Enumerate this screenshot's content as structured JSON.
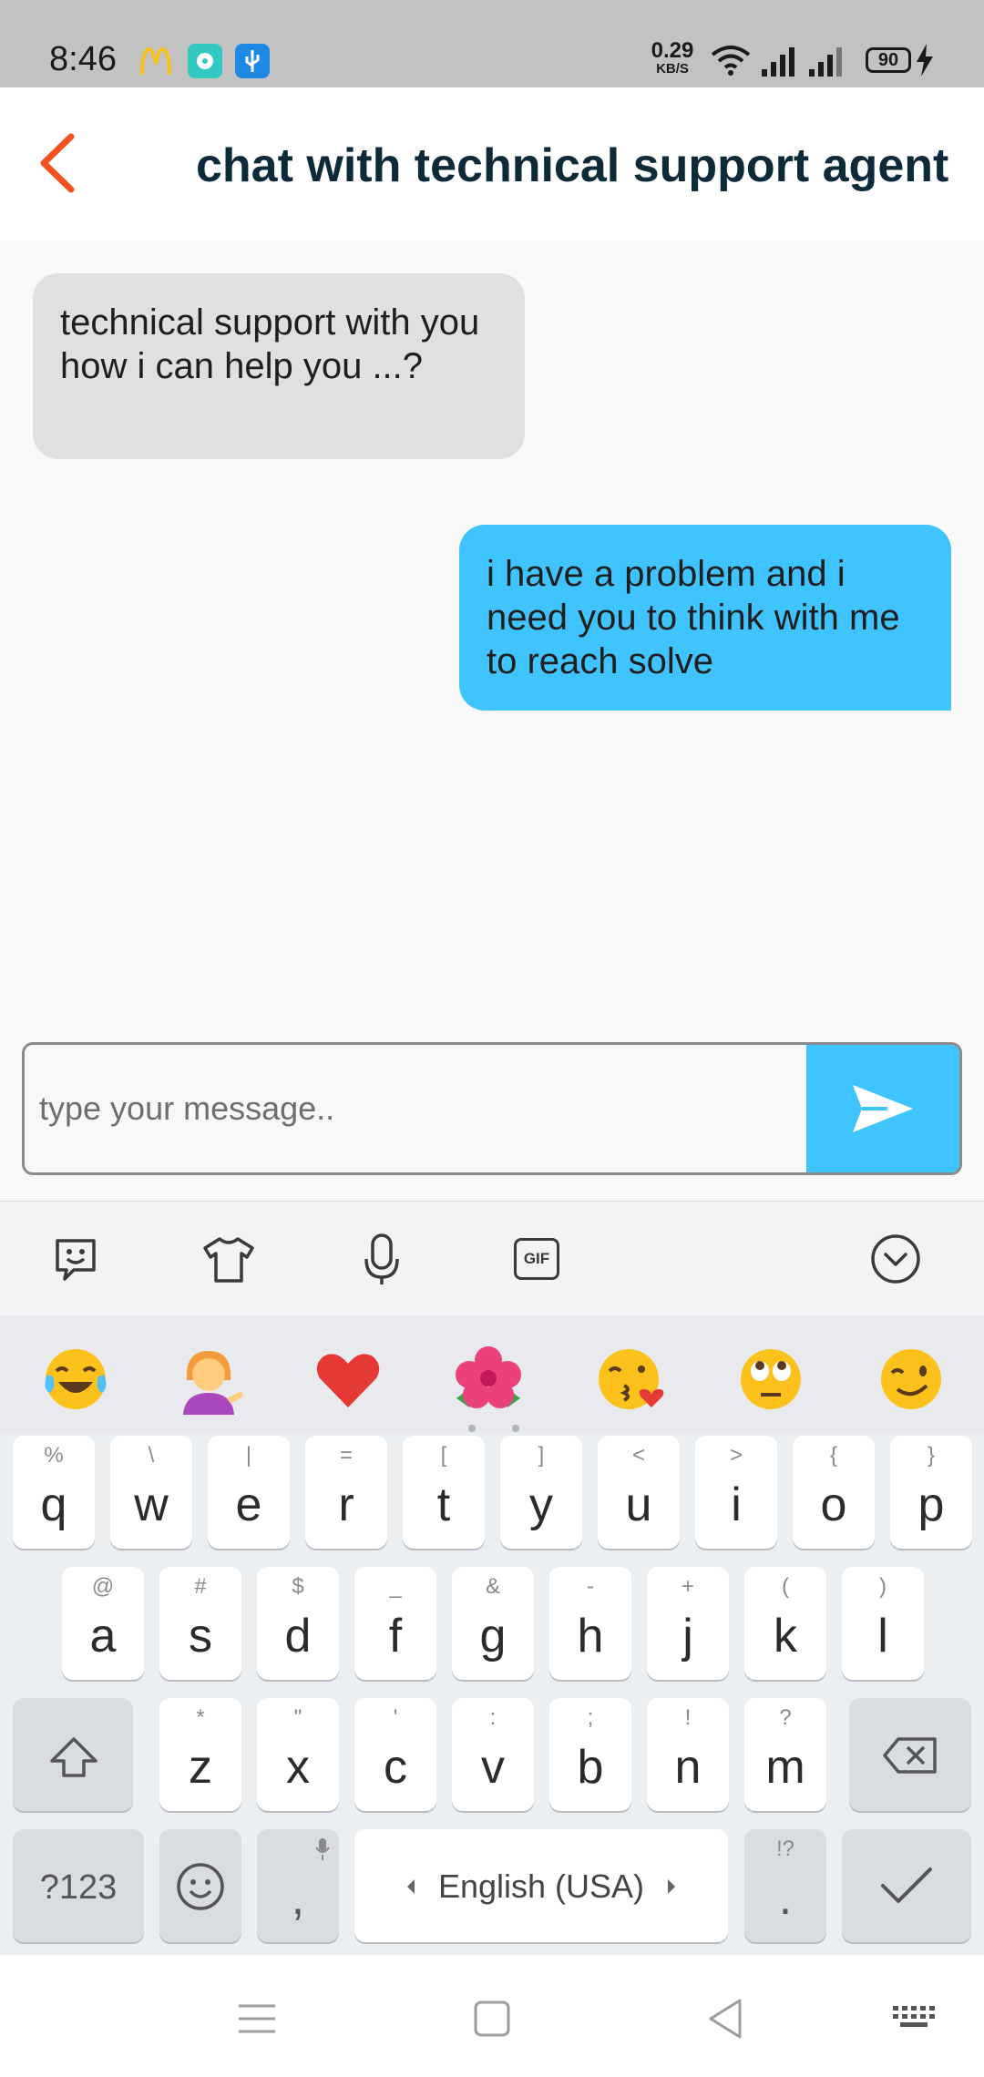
{
  "status_bar": {
    "time": "8:46",
    "net_speed_value": "0.29",
    "net_speed_unit": "KB/S",
    "battery": "90"
  },
  "header": {
    "title": "chat with technical support agent",
    "back_icon": "chevron-left-icon"
  },
  "messages": [
    {
      "direction": "incoming",
      "text": "technical support  with you how i can help you ...?"
    },
    {
      "direction": "outgoing",
      "text": "i have a problem and i need you to think with me to reach solve"
    }
  ],
  "composer": {
    "placeholder": "type your message..",
    "send_icon": "send-icon"
  },
  "keyboard": {
    "toolbar": [
      "sticker-icon",
      "theme-icon",
      "microphone-icon",
      "gif-icon",
      "collapse-icon"
    ],
    "gif_label": "GIF",
    "emoji_suggestions": [
      "😂",
      "💁",
      "❤️",
      "🌺",
      "😘",
      "🙄",
      "😉"
    ],
    "row1": [
      {
        "k": "q",
        "s": "%"
      },
      {
        "k": "w",
        "s": "\\"
      },
      {
        "k": "e",
        "s": "|"
      },
      {
        "k": "r",
        "s": "="
      },
      {
        "k": "t",
        "s": "["
      },
      {
        "k": "y",
        "s": "]"
      },
      {
        "k": "u",
        "s": "<"
      },
      {
        "k": "i",
        "s": ">"
      },
      {
        "k": "o",
        "s": "{"
      },
      {
        "k": "p",
        "s": "}"
      }
    ],
    "row2": [
      {
        "k": "a",
        "s": "@"
      },
      {
        "k": "s",
        "s": "#"
      },
      {
        "k": "d",
        "s": "$"
      },
      {
        "k": "f",
        "s": "_"
      },
      {
        "k": "g",
        "s": "&"
      },
      {
        "k": "h",
        "s": "-"
      },
      {
        "k": "j",
        "s": "+"
      },
      {
        "k": "k",
        "s": "("
      },
      {
        "k": "l",
        "s": ")"
      }
    ],
    "row3": [
      {
        "k": "z",
        "s": "*"
      },
      {
        "k": "x",
        "s": "\""
      },
      {
        "k": "c",
        "s": "'"
      },
      {
        "k": "v",
        "s": ":"
      },
      {
        "k": "b",
        "s": ";"
      },
      {
        "k": "n",
        "s": "!"
      },
      {
        "k": "m",
        "s": "?"
      }
    ],
    "symbols_key": "?123",
    "comma_key": ",",
    "space_label": "English (USA)",
    "period_key": ".",
    "period_sub": "!?"
  },
  "colors": {
    "accent": "#40c4ff",
    "back_arrow": "#f4511e",
    "title": "#0d2a3a",
    "incoming_bubble": "#e0e0e0"
  }
}
